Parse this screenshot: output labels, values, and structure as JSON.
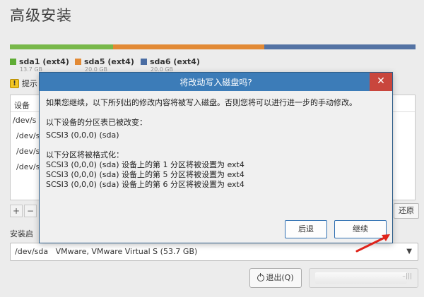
{
  "page": {
    "title": "高级安装"
  },
  "partitions": {
    "bar_colors": [
      "#78b84a",
      "#e28a35",
      "#5473a4"
    ],
    "bar_fractions": [
      0.255,
      0.372,
      0.373
    ],
    "legend": [
      {
        "label": "sda1 (ext4)",
        "size": "13.7 GB",
        "color": "#5fac35"
      },
      {
        "label": "sda5 (ext4)",
        "size": "20.0 GB",
        "color": "#e28a35"
      },
      {
        "label": "sda6 (ext4)",
        "size": "20.0 GB",
        "color": "#4a6da3"
      }
    ]
  },
  "warning": {
    "text": "提示"
  },
  "table": {
    "header": "设备",
    "rows": [
      "/dev/s",
      "/dev/s",
      "/dev/s",
      "/dev/s"
    ]
  },
  "toolbar": {
    "add": "+",
    "remove": "−",
    "revert": "还原"
  },
  "boot": {
    "label": "安装启",
    "device": "/dev/sda",
    "device_desc": "VMware, VMware Virtual S (53.7 GB)"
  },
  "footer": {
    "quit": "退出(Q)",
    "disabled_end": "–|||"
  },
  "dialog": {
    "title": "将改动写入磁盘吗?",
    "close": "✕",
    "intro": "如果您继续，以下所列出的修改内容将被写入磁盘。否则您将可以进行进一步的手动修改。",
    "table_changed_heading": "以下设备的分区表已被改变：",
    "table_changed_items": [
      "SCSI3 (0,0,0) (sda)"
    ],
    "format_heading": "以下分区将被格式化：",
    "format_items": [
      "SCSI3 (0,0,0) (sda) 设备上的第 1 分区将被设置为 ext4",
      "SCSI3 (0,0,0) (sda) 设备上的第 5 分区将被设置为 ext4",
      "SCSI3 (0,0,0) (sda) 设备上的第 6 分区将被设置为 ext4"
    ],
    "back_button": "后退",
    "continue_button": "继续"
  }
}
